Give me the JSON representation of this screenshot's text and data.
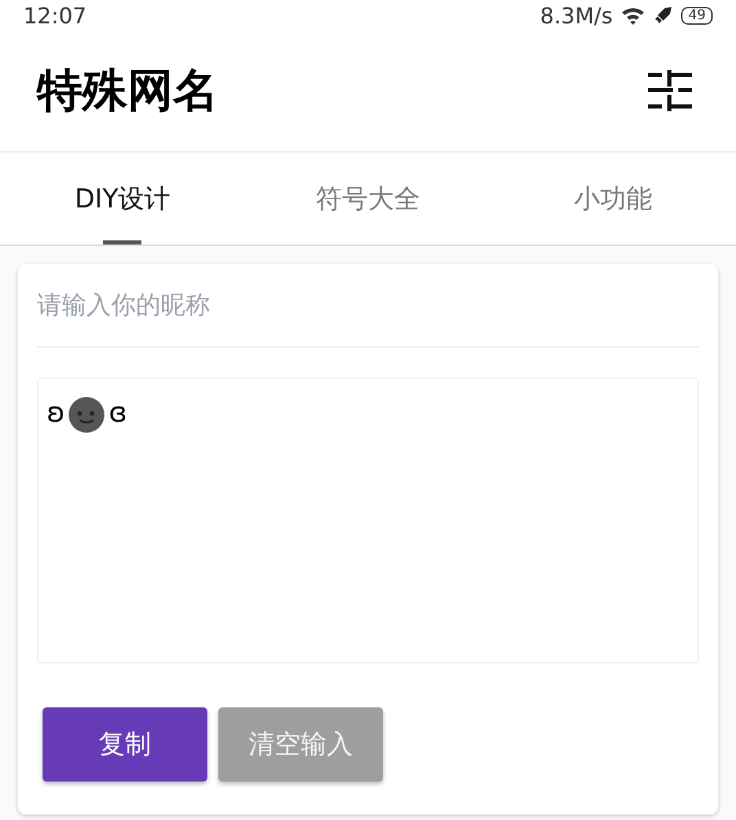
{
  "status_bar": {
    "time": "12:07",
    "speed": "8.3M/s",
    "battery": "49"
  },
  "app_bar": {
    "title": "特殊网名"
  },
  "tabs": [
    {
      "label": "DIY设计",
      "selected": true
    },
    {
      "label": "符号大全",
      "selected": false
    },
    {
      "label": "小功能",
      "selected": false
    }
  ],
  "nickname_field": {
    "placeholder": "请输入你的昵称"
  },
  "output": {
    "prefix": "ʚ",
    "suffix": "ɞ"
  },
  "buttons": [
    {
      "label": "复制",
      "disabled": false
    },
    {
      "label": "清空输入",
      "disabled": true
    }
  ]
}
